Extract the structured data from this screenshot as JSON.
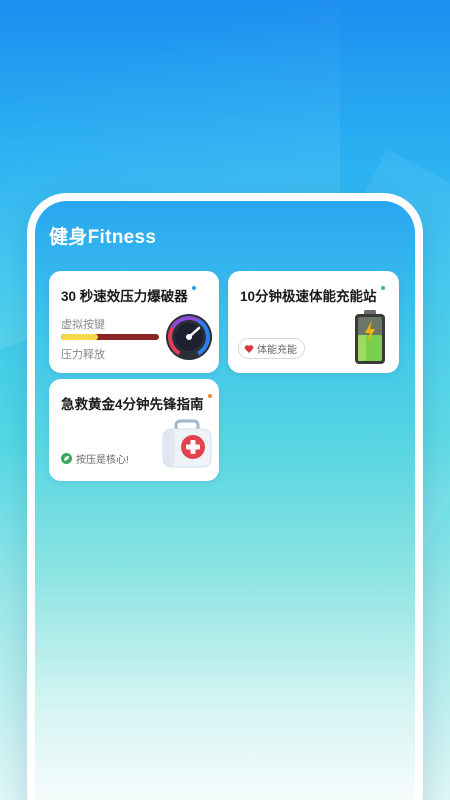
{
  "app": {
    "title": "健身Fitness"
  },
  "cards": [
    {
      "title": "30 秒速效压力爆破器",
      "dot_color": "#2f9de8",
      "label_top": "虚拟按键",
      "label_bottom": "压力释放",
      "progress": 0.38,
      "icon": "speedometer-gauge-icon"
    },
    {
      "title": "10分钟极速体能充能站",
      "dot_color": "#3cc46a",
      "tag": "体能充能",
      "tag_icon": "heart-icon",
      "icon": "battery-charging-icon"
    },
    {
      "title": "急救黄金4分钟先锋指南",
      "dot_color": "#f08a3c",
      "tip": "按压是核心!",
      "tip_icon": "leaf-icon",
      "icon": "first-aid-kit-icon"
    }
  ],
  "colors": {
    "bar_track": "#8b2525",
    "bar_fill": "#f7d84a",
    "accent_blue": "#2f9de8"
  }
}
